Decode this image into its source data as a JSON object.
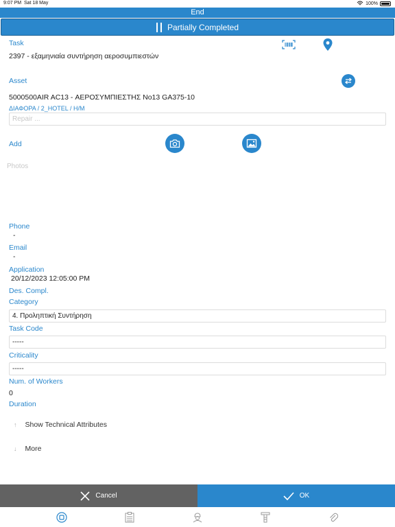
{
  "status_bar": {
    "time": "9:07 PM",
    "date": "Sat 18 May",
    "battery": "100%"
  },
  "header": {
    "end_label": "End",
    "status_label": "Partially Completed"
  },
  "task": {
    "label": "Task",
    "value": "2397 - εξαμηνιαία συντήρηση αεροσυμπιεστών"
  },
  "asset": {
    "label": "Asset",
    "value": "5000500AIR AC13 - ΑΕΡΟΣΥΜΠΙΕΣΤΗΣ Νο13 GA375-10",
    "path": "ΔΙΑΦΟΡΑ / 2_HOTEL  / Η/Μ",
    "repair_placeholder": "Repair ..."
  },
  "add": {
    "label": "Add",
    "photos_label": "Photos"
  },
  "phone": {
    "label": "Phone",
    "value": "-"
  },
  "email": {
    "label": "Email",
    "value": "-"
  },
  "application": {
    "label": "Application",
    "value": "20/12/2023 12:05:00 PM"
  },
  "des_compl": {
    "label": "Des. Compl."
  },
  "category": {
    "label": "Category",
    "value": "4. Προληπτική Συντήρηση"
  },
  "task_code": {
    "label": "Task Code",
    "value": "-----"
  },
  "criticality": {
    "label": "Criticality",
    "value": "-----"
  },
  "workers": {
    "label": "Num. of Workers",
    "value": "0"
  },
  "duration": {
    "label": "Duration"
  },
  "expanders": {
    "tech_attrs": "Show Technical Attributes",
    "more": "More"
  },
  "footer": {
    "cancel_label": "Cancel",
    "ok_label": "OK"
  },
  "icons": {
    "barcode": "barcode-icon",
    "location": "location-pin-icon",
    "swap": "swap-icon",
    "camera": "camera-icon",
    "gallery": "image-icon",
    "tabs": [
      "home-icon",
      "checklist-icon",
      "worker-icon",
      "tools-icon",
      "attachment-icon"
    ]
  },
  "colors": {
    "accent": "#2a87cc",
    "cancel": "#626262"
  }
}
